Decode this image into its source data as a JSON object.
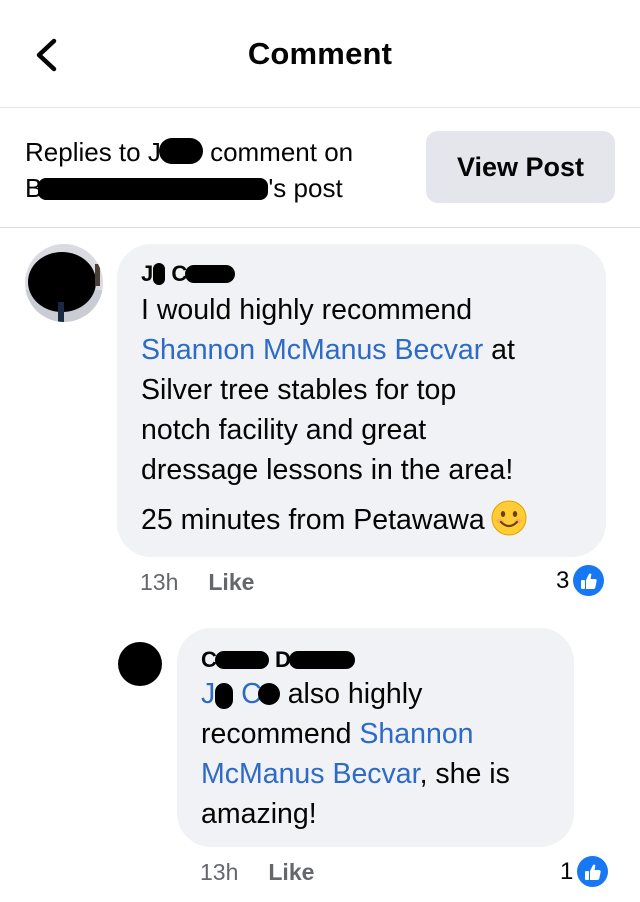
{
  "header": {
    "title": "Comment",
    "back_icon": "chevron-left-icon"
  },
  "context": {
    "prefix": "Replies to J",
    "mid": " comment on",
    "line2_start": "B",
    "line2_end": "'s post",
    "view_post_label": "View Post"
  },
  "comments": [
    {
      "author_visible": "J",
      "author_visible2": "C",
      "text_lines": [
        "I would highly recommend",
        "Shannon McManus Becvar",
        " at",
        "Silver tree stables for top",
        "notch facility and great",
        "dressage lessons in the area!"
      ],
      "text_line2": "25 minutes from Petawawa",
      "emoji": "smiling-face-emoji",
      "time": "13h",
      "like_label": "Like",
      "reaction_count": "3",
      "reaction_icon": "thumbs-up-icon"
    },
    {
      "author_visible": "C",
      "author_visible2": "D",
      "mention_start": "J",
      "mention_start2": "C",
      "text_after_mention": "also highly",
      "text_line_b_pre": "recommend ",
      "mention_b": "Shannon",
      "mention_c": "McManus Becvar",
      "text_line_c_post": ", she is",
      "text_line_d": "amazing!",
      "time": "13h",
      "like_label": "Like",
      "reaction_count": "1",
      "reaction_icon": "thumbs-up-icon"
    }
  ],
  "colors": {
    "mention": "#2d6bc7",
    "bubble": "#f0f2f5",
    "like_badge": "#1877f2",
    "meta": "#65676b"
  }
}
